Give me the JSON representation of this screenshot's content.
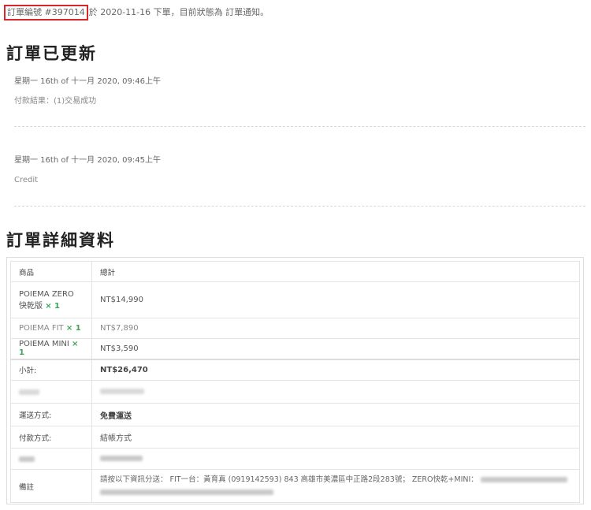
{
  "intro": {
    "order_label": "訂單編號 #397014",
    "rest": "於 2020-11-16 下單，目前狀態為 訂單通知。"
  },
  "updates": {
    "heading": "訂單已更新",
    "notes": [
      {
        "date": "星期一 16th of 十一月 2020, 09:46上午",
        "text": "付款結果：(1)交易成功"
      },
      {
        "date": "星期一 16th of 十一月 2020, 09:45上午",
        "text": "Credit"
      }
    ]
  },
  "details": {
    "heading": "訂單詳細資料",
    "col_product": "商品",
    "col_total": "總計",
    "items": [
      {
        "name": "POIEMA ZERO 快乾版",
        "qty": "× 1",
        "total": "NT$14,990"
      },
      {
        "name": "POIEMA FIT",
        "qty": "× 1",
        "total": "NT$7,890"
      },
      {
        "name": "POIEMA MINI",
        "qty": "× 1",
        "total": "NT$3,590"
      }
    ],
    "subtotal_label": "小計:",
    "subtotal_value": "NT$26,470",
    "shipping_label": "運送方式:",
    "shipping_value": "免費運送",
    "payment_label": "付款方式:",
    "payment_value": "結帳方式",
    "note_label": "備註",
    "note_value": "請按以下資訊分送： FIT一台：黃育真 (0919142593) 843 高雄市美濃區中正路2段283號； ZERO快乾+MINI："
  }
}
